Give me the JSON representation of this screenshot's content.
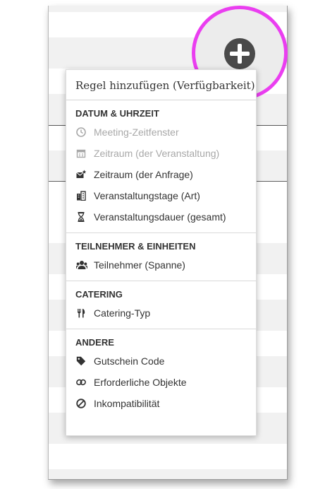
{
  "menu": {
    "header": "Regel hinzufügen (Verfügbarkeit)",
    "sections": [
      {
        "title": "DATUM & UHRZEIT",
        "items": [
          {
            "label": "Meeting-Zeitfenster",
            "icon": "clock-icon",
            "disabled": true
          },
          {
            "label": "Zeitraum (der Veranstaltung)",
            "icon": "calendar-icon",
            "disabled": true
          },
          {
            "label": "Zeitraum (der Anfrage)",
            "icon": "envelope-star-icon",
            "disabled": false
          },
          {
            "label": "Veranstaltungstage (Art)",
            "icon": "building-days-icon",
            "disabled": false
          },
          {
            "label": "Veranstaltungsdauer (gesamt)",
            "icon": "hourglass-icon",
            "disabled": false
          }
        ]
      },
      {
        "title": "TEILNEHMER & EINHEITEN",
        "items": [
          {
            "label": "Teilnehmer (Spanne)",
            "icon": "users-icon",
            "disabled": false
          }
        ]
      },
      {
        "title": "CATERING",
        "items": [
          {
            "label": "Catering-Typ",
            "icon": "cutlery-icon",
            "disabled": false
          }
        ]
      },
      {
        "title": "ANDERE",
        "items": [
          {
            "label": "Gutschein Code",
            "icon": "tag-icon",
            "disabled": false
          },
          {
            "label": "Erforderliche Objekte",
            "icon": "link-icon",
            "disabled": false
          },
          {
            "label": "Inkompatibilität",
            "icon": "ban-icon",
            "disabled": false
          }
        ]
      }
    ]
  },
  "colors": {
    "highlight": "#ea3ef0",
    "disabled": "#a8a8a8",
    "text": "#333333"
  }
}
